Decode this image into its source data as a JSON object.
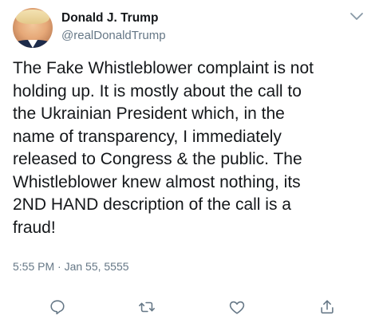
{
  "author": {
    "name": "Donald J. Trump",
    "handle": "@realDonaldTrump"
  },
  "tweet": {
    "text": "The Fake Whistleblower complaint is not\nholding up. It is mostly about the call to\nthe Ukrainian President which, in the\nname of transparency, I immediately\nreleased to Congress & the public. The\nWhistleblower knew almost nothing, its\n2ND HAND description of the call is a\nfraud!",
    "timestamp": "5:55 PM · Jan 55, 5555"
  },
  "icons": {
    "more": "chevron-down-icon",
    "reply": "reply-icon",
    "retweet": "retweet-icon",
    "like": "heart-icon",
    "share": "share-icon"
  },
  "colors": {
    "text": "#14171a",
    "secondary": "#657786"
  }
}
